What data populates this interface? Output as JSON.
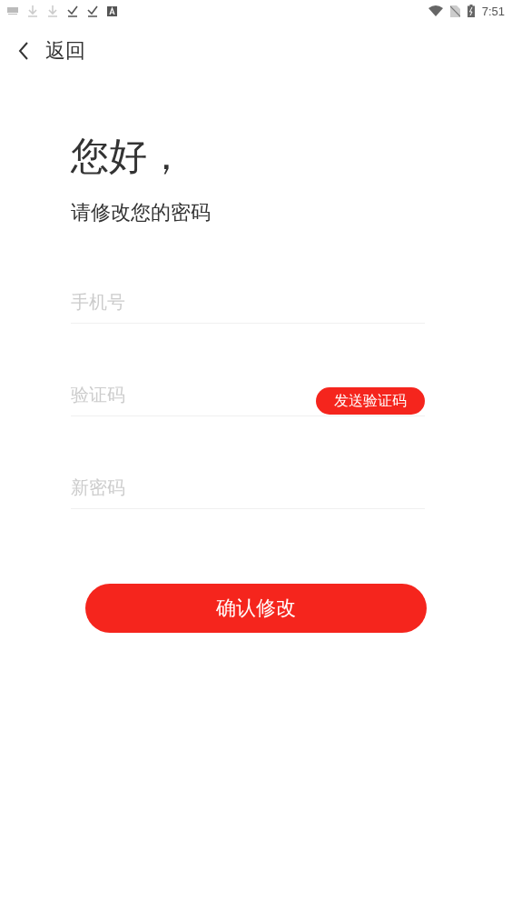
{
  "status_bar": {
    "time": "7:51"
  },
  "nav": {
    "back_label": "返回"
  },
  "greeting": "您好，",
  "subtitle": "请修改您的密码",
  "fields": [
    {
      "kind": "plain",
      "placeholder": "手机号"
    },
    {
      "kind": "code",
      "placeholder": "验证码",
      "button": "发送验证码"
    },
    {
      "kind": "plain",
      "placeholder": "新密码"
    }
  ],
  "submit": "确认修改"
}
